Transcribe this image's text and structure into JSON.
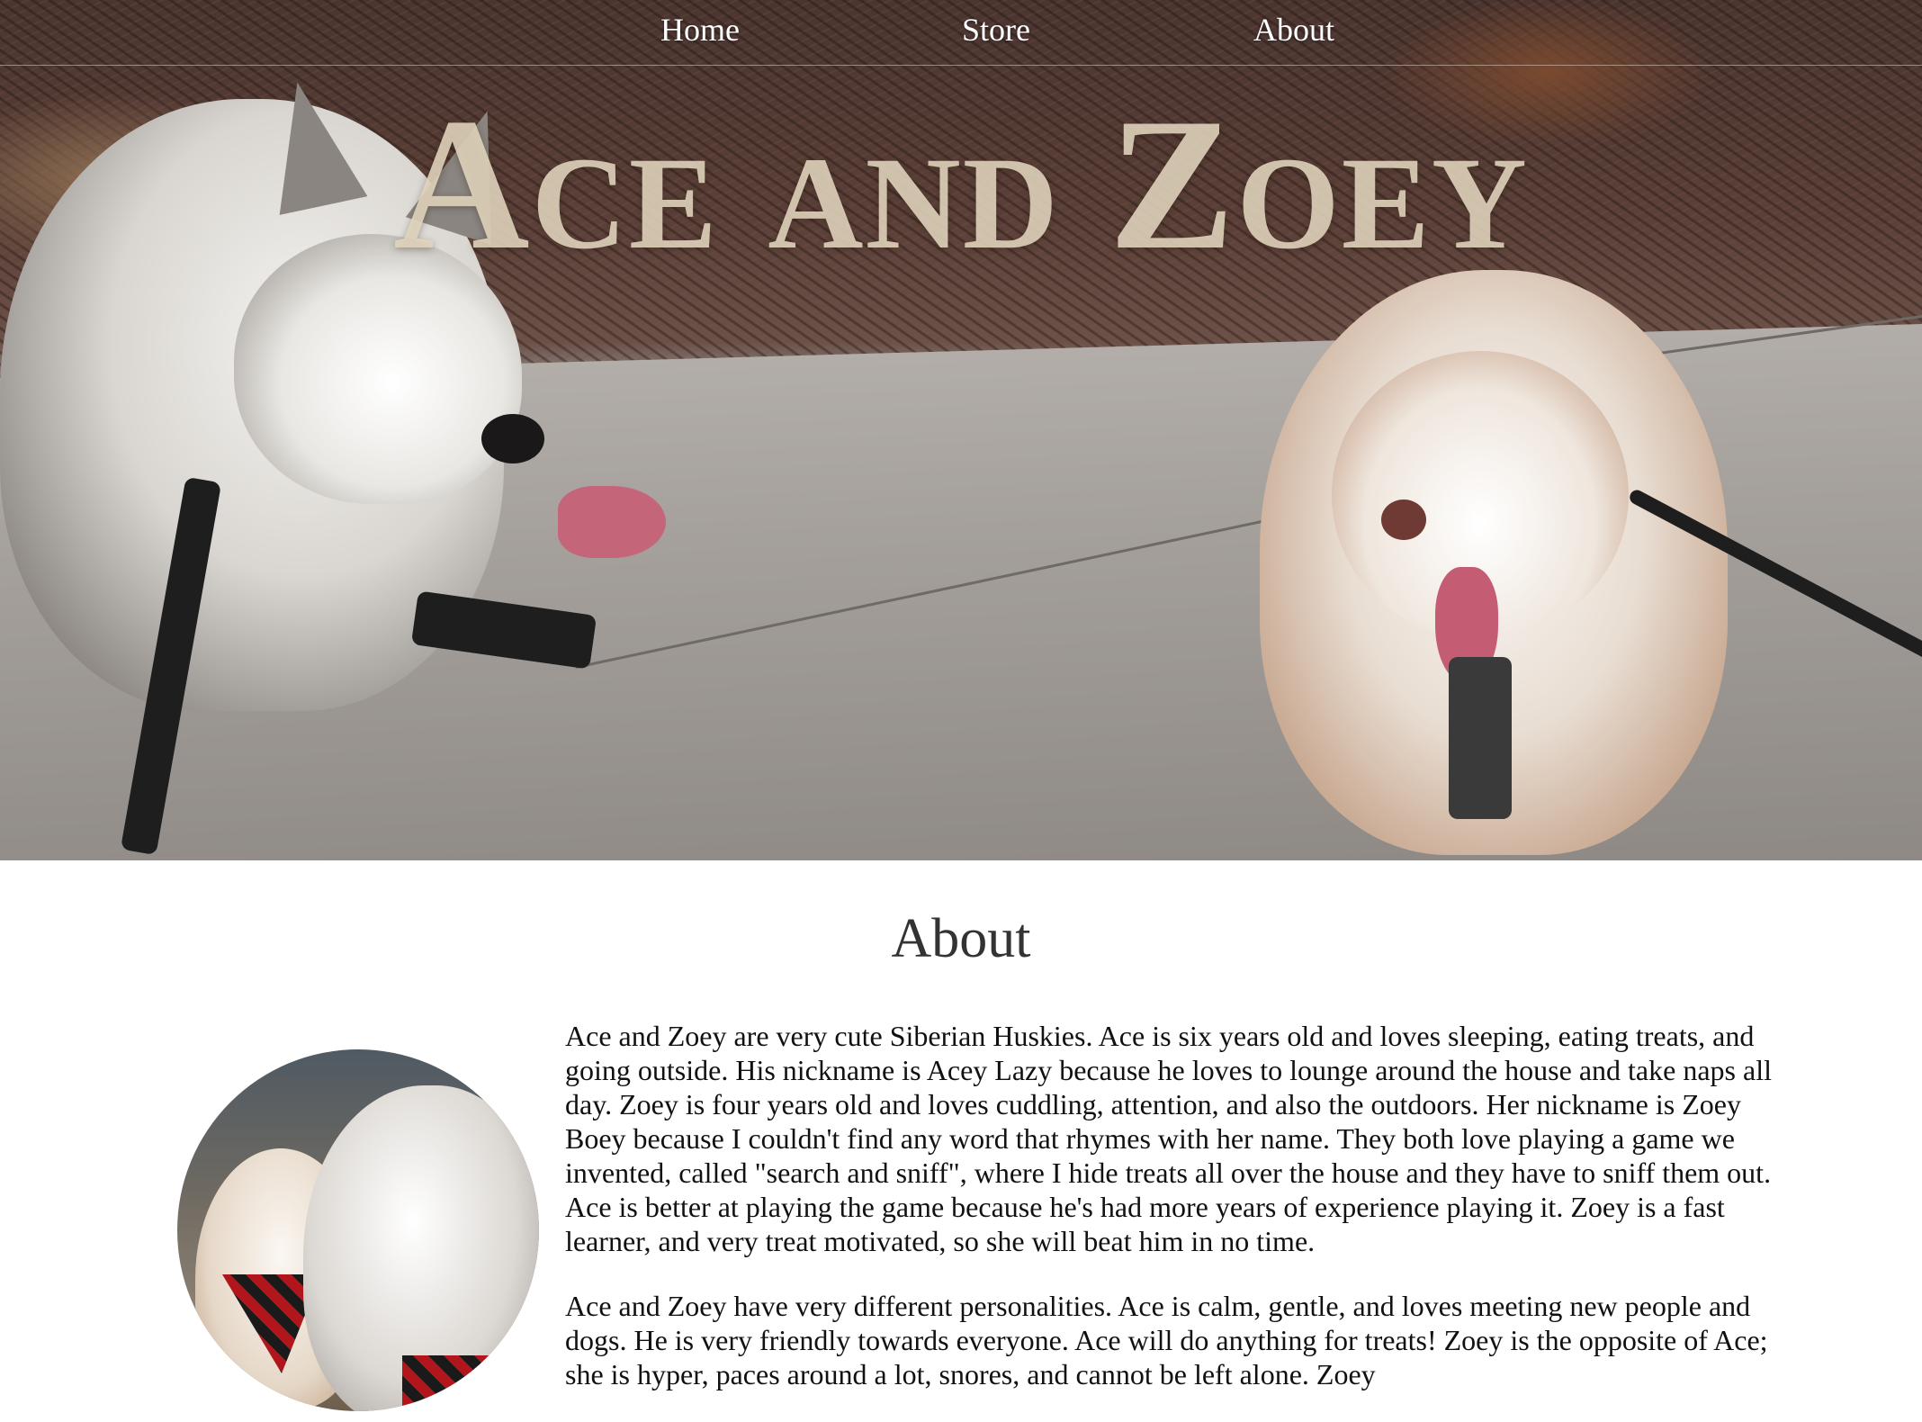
{
  "nav": {
    "links": [
      {
        "label": "Home"
      },
      {
        "label": "Store"
      },
      {
        "label": "About"
      }
    ]
  },
  "hero": {
    "title": "Ace and Zoey"
  },
  "about": {
    "heading": "About",
    "paragraphs": [
      "Ace and Zoey are very cute Siberian Huskies. Ace is six years old and loves sleeping, eating treats, and going outside. His nickname is Acey Lazy because he loves to lounge around the house and take naps all day. Zoey is four years old and loves cuddling, attention, and also the outdoors. Her nickname is Zoey Boey because I couldn't find any word that rhymes with her name. They both love playing a game we invented, called \"search and sniff\", where I hide treats all over the house and they have to sniff them out. Ace is better at playing the game because he's had more years of experience playing it. Zoey is a fast learner, and very treat motivated, so she will beat him in no time.",
      "Ace and Zoey have very different personalities. Ace is calm, gentle, and loves meeting new people and dogs. He is very friendly towards everyone. Ace will do anything for treats! Zoey is the opposite of Ace; she is hyper, paces around a lot, snores, and cannot be left alone. Zoey"
    ]
  }
}
